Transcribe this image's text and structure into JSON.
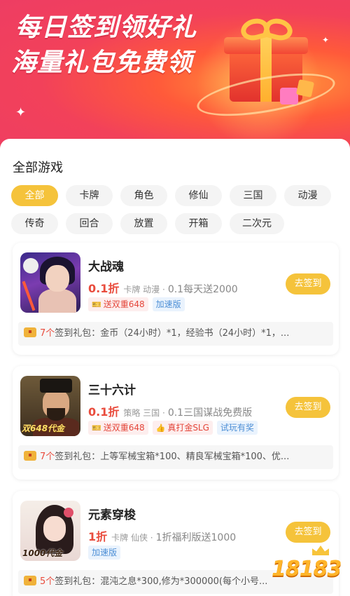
{
  "banner": {
    "title": "每日签到领好礼",
    "subtitle": "海量礼包免费领"
  },
  "section": {
    "title": "全部游戏"
  },
  "tags": [
    "全部",
    "卡牌",
    "角色",
    "修仙",
    "三国",
    "动漫",
    "传奇",
    "回合",
    "放置",
    "开箱",
    "二次元"
  ],
  "active_tag": "全部",
  "games": [
    {
      "name": "大战魂",
      "discount": "0.1折",
      "categories": "卡牌 动漫 ·",
      "desc": "0.1每天送2000",
      "badges": [
        {
          "text": "送双重648",
          "style": "red",
          "icon": "gift-ticket-icon"
        },
        {
          "text": "加速版",
          "style": "blue"
        }
      ],
      "button": "去签到",
      "gift_count": "7个",
      "gift_label": "签到礼包：",
      "gift_desc": "金币（24小时）*1，经验书（24小时）*1，..."
    },
    {
      "name": "三十六计",
      "discount": "0.1折",
      "categories": "策略 三国 ·",
      "desc": "0.1三国谋战免费版",
      "thumb_text": "双648代金",
      "badges": [
        {
          "text": "送双重648",
          "style": "red",
          "icon": "gift-ticket-icon"
        },
        {
          "text": "真打金SLG",
          "style": "red",
          "icon": "thumb-icon"
        },
        {
          "text": "试玩有奖",
          "style": "blue"
        }
      ],
      "button": "去签到",
      "gift_count": "7个",
      "gift_label": "签到礼包：",
      "gift_desc": "上等军械宝箱*100、精良军械宝箱*100、优..."
    },
    {
      "name": "元素穿梭",
      "discount": "1折",
      "categories": "卡牌 仙侠 ·",
      "desc": "1折福利版送1000",
      "thumb_text": "1000代金",
      "badges": [
        {
          "text": "加速版",
          "style": "blue"
        }
      ],
      "button": "去签到",
      "gift_count": "5个",
      "gift_label": "签到礼包：",
      "gift_desc": "混沌之息*300,修为*300000(每个小号..."
    }
  ],
  "watermark": "18183"
}
